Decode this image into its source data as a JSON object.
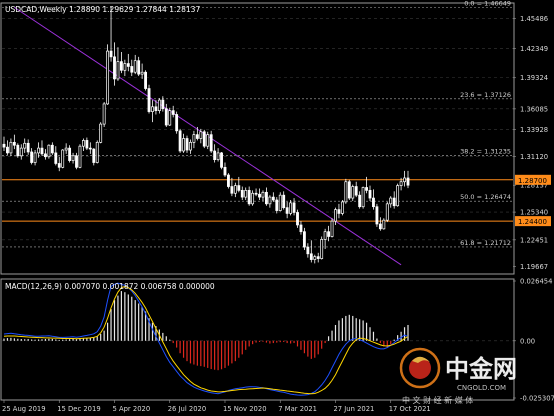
{
  "chart_data": [
    {
      "type": "candlestick",
      "header": "USDCAD,Weekly  1.28890 1.29629 1.27844 1.28137",
      "symbol": "USDCAD",
      "timeframe": "Weekly",
      "ohlc_last": {
        "open": 1.2889,
        "high": 1.29629,
        "low": 1.27844,
        "close": 1.28137
      },
      "ylim": [
        1.19667,
        1.46649
      ],
      "y_ticks": [
        "1.45486",
        "1.42349",
        "1.39324",
        "1.36085",
        "1.33928",
        "1.31120",
        "1.28137",
        "1.25340",
        "1.22451",
        "1.19667"
      ],
      "x_ticks": [
        "25 Aug 2019",
        "15 Dec 2019",
        "5 Apr 2020",
        "26 Jul 2020",
        "15 Nov 2020",
        "7 Mar 2021",
        "27 Jun 2021",
        "17 Oct 2021"
      ],
      "fib_levels": [
        {
          "label": "0.0 = 1.46649",
          "value": 1.46649
        },
        {
          "label": "23.6 = 1.37126",
          "value": 1.37126
        },
        {
          "label": "38.2 = 1.31235",
          "value": 1.31235
        },
        {
          "label": "50.0 = 1.26474",
          "value": 1.26474
        },
        {
          "label": "61.8 = 1.21712",
          "value": 1.21712
        }
      ],
      "horizontal_lines": [
        {
          "label": "1.28700",
          "value": 1.287,
          "color": "#ff8c1a"
        },
        {
          "label": "1.24400",
          "value": 1.244,
          "color": "#ff8c1a"
        }
      ],
      "current_price_label": "1.28137",
      "trendline": {
        "from": [
          3,
          1.4665
        ],
        "to": [
          115,
          1.1985
        ],
        "color": "#9b30d9"
      },
      "candles": [
        [
          1.324,
          1.332,
          1.317,
          1.321
        ],
        [
          1.321,
          1.328,
          1.313,
          1.315
        ],
        [
          1.315,
          1.33,
          1.312,
          1.326
        ],
        [
          1.326,
          1.334,
          1.319,
          1.323
        ],
        [
          1.323,
          1.325,
          1.31,
          1.312
        ],
        [
          1.312,
          1.324,
          1.308,
          1.32
        ],
        [
          1.32,
          1.33,
          1.315,
          1.325
        ],
        [
          1.325,
          1.329,
          1.313,
          1.316
        ],
        [
          1.316,
          1.32,
          1.303,
          1.305
        ],
        [
          1.305,
          1.318,
          1.302,
          1.315
        ],
        [
          1.315,
          1.326,
          1.31,
          1.32
        ],
        [
          1.32,
          1.328,
          1.312,
          1.314
        ],
        [
          1.314,
          1.319,
          1.308,
          1.311
        ],
        [
          1.311,
          1.324,
          1.309,
          1.323
        ],
        [
          1.323,
          1.326,
          1.313,
          1.315
        ],
        [
          1.315,
          1.322,
          1.302,
          1.304
        ],
        [
          1.304,
          1.311,
          1.296,
          1.3
        ],
        [
          1.3,
          1.319,
          1.299,
          1.318
        ],
        [
          1.318,
          1.325,
          1.314,
          1.32
        ],
        [
          1.32,
          1.323,
          1.305,
          1.307
        ],
        [
          1.307,
          1.315,
          1.304,
          1.312
        ],
        [
          1.312,
          1.315,
          1.298,
          1.3
        ],
        [
          1.3,
          1.324,
          1.299,
          1.322
        ],
        [
          1.322,
          1.33,
          1.317,
          1.328
        ],
        [
          1.328,
          1.331,
          1.318,
          1.32
        ],
        [
          1.32,
          1.326,
          1.314,
          1.319
        ],
        [
          1.319,
          1.32,
          1.302,
          1.305
        ],
        [
          1.305,
          1.328,
          1.304,
          1.326
        ],
        [
          1.326,
          1.347,
          1.325,
          1.345
        ],
        [
          1.345,
          1.368,
          1.342,
          1.366
        ],
        [
          1.366,
          1.428,
          1.365,
          1.421
        ],
        [
          1.421,
          1.467,
          1.41,
          1.415
        ],
        [
          1.415,
          1.43,
          1.385,
          1.392
        ],
        [
          1.392,
          1.425,
          1.39,
          1.41
        ],
        [
          1.41,
          1.42,
          1.398,
          1.401
        ],
        [
          1.401,
          1.412,
          1.395,
          1.408
        ],
        [
          1.408,
          1.418,
          1.4,
          1.405
        ],
        [
          1.405,
          1.412,
          1.395,
          1.399
        ],
        [
          1.399,
          1.417,
          1.397,
          1.411
        ],
        [
          1.411,
          1.415,
          1.395,
          1.397
        ],
        [
          1.397,
          1.408,
          1.392,
          1.399
        ],
        [
          1.399,
          1.401,
          1.38,
          1.382
        ],
        [
          1.382,
          1.386,
          1.356,
          1.358
        ],
        [
          1.358,
          1.37,
          1.347,
          1.363
        ],
        [
          1.363,
          1.37,
          1.355,
          1.359
        ],
        [
          1.359,
          1.372,
          1.356,
          1.37
        ],
        [
          1.37,
          1.374,
          1.358,
          1.361
        ],
        [
          1.361,
          1.366,
          1.342,
          1.344
        ],
        [
          1.344,
          1.362,
          1.343,
          1.359
        ],
        [
          1.359,
          1.364,
          1.352,
          1.355
        ],
        [
          1.355,
          1.358,
          1.335,
          1.338
        ],
        [
          1.338,
          1.34,
          1.315,
          1.317
        ],
        [
          1.317,
          1.335,
          1.315,
          1.33
        ],
        [
          1.33,
          1.333,
          1.315,
          1.318
        ],
        [
          1.318,
          1.329,
          1.314,
          1.326
        ],
        [
          1.326,
          1.338,
          1.32,
          1.334
        ],
        [
          1.334,
          1.342,
          1.328,
          1.33
        ],
        [
          1.33,
          1.34,
          1.325,
          1.337
        ],
        [
          1.337,
          1.339,
          1.32,
          1.322
        ],
        [
          1.322,
          1.337,
          1.319,
          1.334
        ],
        [
          1.334,
          1.338,
          1.315,
          1.317
        ],
        [
          1.317,
          1.324,
          1.305,
          1.308
        ],
        [
          1.308,
          1.32,
          1.306,
          1.315
        ],
        [
          1.315,
          1.316,
          1.298,
          1.3
        ],
        [
          1.3,
          1.305,
          1.29,
          1.292
        ],
        [
          1.292,
          1.294,
          1.278,
          1.28
        ],
        [
          1.28,
          1.289,
          1.27,
          1.273
        ],
        [
          1.273,
          1.284,
          1.269,
          1.281
        ],
        [
          1.281,
          1.29,
          1.274,
          1.276
        ],
        [
          1.276,
          1.28,
          1.266,
          1.269
        ],
        [
          1.269,
          1.279,
          1.266,
          1.276
        ],
        [
          1.276,
          1.28,
          1.26,
          1.262
        ],
        [
          1.262,
          1.276,
          1.26,
          1.273
        ],
        [
          1.273,
          1.278,
          1.27,
          1.272
        ],
        [
          1.272,
          1.278,
          1.266,
          1.269
        ],
        [
          1.269,
          1.276,
          1.265,
          1.274
        ],
        [
          1.274,
          1.279,
          1.26,
          1.262
        ],
        [
          1.262,
          1.271,
          1.258,
          1.269
        ],
        [
          1.269,
          1.274,
          1.264,
          1.266
        ],
        [
          1.266,
          1.269,
          1.252,
          1.255
        ],
        [
          1.255,
          1.274,
          1.254,
          1.271
        ],
        [
          1.271,
          1.275,
          1.256,
          1.258
        ],
        [
          1.258,
          1.264,
          1.247,
          1.252
        ],
        [
          1.252,
          1.266,
          1.25,
          1.263
        ],
        [
          1.263,
          1.268,
          1.25,
          1.253
        ],
        [
          1.253,
          1.256,
          1.237,
          1.24
        ],
        [
          1.24,
          1.244,
          1.23,
          1.233
        ],
        [
          1.233,
          1.237,
          1.214,
          1.217
        ],
        [
          1.217,
          1.221,
          1.206,
          1.21
        ],
        [
          1.21,
          1.224,
          1.201,
          1.204
        ],
        [
          1.204,
          1.209,
          1.2,
          1.207
        ],
        [
          1.207,
          1.211,
          1.201,
          1.205
        ],
        [
          1.205,
          1.228,
          1.204,
          1.225
        ],
        [
          1.225,
          1.236,
          1.215,
          1.233
        ],
        [
          1.233,
          1.239,
          1.223,
          1.228
        ],
        [
          1.228,
          1.247,
          1.227,
          1.244
        ],
        [
          1.244,
          1.258,
          1.24,
          1.256
        ],
        [
          1.256,
          1.262,
          1.247,
          1.252
        ],
        [
          1.252,
          1.266,
          1.25,
          1.264
        ],
        [
          1.264,
          1.288,
          1.262,
          1.285
        ],
        [
          1.285,
          1.287,
          1.266,
          1.268
        ],
        [
          1.268,
          1.282,
          1.265,
          1.28
        ],
        [
          1.28,
          1.285,
          1.269,
          1.271
        ],
        [
          1.271,
          1.275,
          1.257,
          1.259
        ],
        [
          1.259,
          1.28,
          1.257,
          1.279
        ],
        [
          1.279,
          1.29,
          1.273,
          1.276
        ],
        [
          1.276,
          1.281,
          1.265,
          1.268
        ],
        [
          1.268,
          1.277,
          1.256,
          1.259
        ],
        [
          1.259,
          1.262,
          1.238,
          1.241
        ],
        [
          1.241,
          1.248,
          1.234,
          1.236
        ],
        [
          1.236,
          1.247,
          1.235,
          1.245
        ],
        [
          1.245,
          1.264,
          1.243,
          1.262
        ],
        [
          1.262,
          1.27,
          1.258,
          1.268
        ],
        [
          1.268,
          1.275,
          1.257,
          1.26
        ],
        [
          1.26,
          1.283,
          1.259,
          1.281
        ],
        [
          1.281,
          1.289,
          1.276,
          1.285
        ],
        [
          1.285,
          1.2963,
          1.28,
          1.2889
        ],
        [
          1.2889,
          1.2963,
          1.2784,
          1.2814
        ]
      ]
    },
    {
      "type": "macd",
      "header": "MACD(12,26,9) 0.007070 0.001872 0.006758 0.000000",
      "params": "MACD(12,26,9)",
      "values_label": [
        "0.007070",
        "0.001872",
        "0.006758",
        "0.000000"
      ],
      "ylim": [
        -0.025307,
        0.026454
      ],
      "y_ticks": [
        "0.026454",
        "0.00",
        "-0.025307"
      ],
      "signal_color": "#ffd700",
      "main_line_color": "#1e50ff",
      "histogram": [
        0.001,
        0.0012,
        0.0013,
        0.0011,
        0.0009,
        0.0008,
        0.0007,
        0.0008,
        0.0006,
        0.0005,
        0.0006,
        0.0007,
        0.0008,
        0.0009,
        0.0008,
        0.0006,
        0.0004,
        0.0005,
        0.0006,
        0.0007,
        0.0008,
        0.0007,
        0.0008,
        0.001,
        0.0012,
        0.0014,
        0.0016,
        0.002,
        0.003,
        0.0045,
        0.008,
        0.014,
        0.018,
        0.02,
        0.022,
        0.0215,
        0.0205,
        0.0195,
        0.018,
        0.0165,
        0.015,
        0.013,
        0.01,
        0.008,
        0.0065,
        0.005,
        0.0035,
        0.002,
        0.0005,
        -0.001,
        -0.003,
        -0.0055,
        -0.0075,
        -0.009,
        -0.01,
        -0.0105,
        -0.011,
        -0.0112,
        -0.0115,
        -0.012,
        -0.0125,
        -0.0128,
        -0.013,
        -0.0126,
        -0.012,
        -0.011,
        -0.01,
        -0.009,
        -0.0075,
        -0.006,
        -0.004,
        -0.0025,
        -0.0015,
        -0.0008,
        -0.0005,
        -0.0004,
        -0.0008,
        -0.0012,
        -0.001,
        -0.0008,
        -0.0006,
        -0.0005,
        -0.001,
        -0.0012,
        -0.001,
        -0.0025,
        -0.004,
        -0.0055,
        -0.007,
        -0.008,
        -0.0075,
        -0.006,
        -0.0035,
        -0.001,
        0.002,
        0.0045,
        0.007,
        0.009,
        0.01,
        0.011,
        0.0115,
        0.011,
        0.01,
        0.0095,
        0.009,
        0.008,
        0.006,
        0.004,
        0.001,
        -0.001,
        -0.0025,
        -0.003,
        -0.0015,
        0.0005,
        0.0025,
        0.004,
        0.006,
        0.007
      ],
      "signal": [
        0.002,
        0.0021,
        0.0021,
        0.0021,
        0.002,
        0.0019,
        0.0018,
        0.0017,
        0.0016,
        0.0015,
        0.0014,
        0.0014,
        0.0013,
        0.0013,
        0.0012,
        0.0012,
        0.0011,
        0.001,
        0.001,
        0.001,
        0.001,
        0.0009,
        0.001,
        0.0011,
        0.0012,
        0.0013,
        0.0015,
        0.002,
        0.0035,
        0.006,
        0.01,
        0.0145,
        0.0185,
        0.0215,
        0.0235,
        0.024,
        0.0235,
        0.0225,
        0.021,
        0.019,
        0.017,
        0.0145,
        0.0115,
        0.0085,
        0.0055,
        0.0025,
        -0.0005,
        -0.0035,
        -0.0065,
        -0.009,
        -0.011,
        -0.013,
        -0.015,
        -0.0165,
        -0.018,
        -0.0192,
        -0.02,
        -0.0208,
        -0.0213,
        -0.0218,
        -0.0222,
        -0.0224,
        -0.0226,
        -0.0225,
        -0.0224,
        -0.0222,
        -0.022,
        -0.0218,
        -0.0216,
        -0.0215,
        -0.0214,
        -0.0213,
        -0.0212,
        -0.0211,
        -0.021,
        -0.0209,
        -0.021,
        -0.0212,
        -0.0214,
        -0.0216,
        -0.0218,
        -0.022,
        -0.0222,
        -0.0224,
        -0.0226,
        -0.0228,
        -0.023,
        -0.0232,
        -0.0233,
        -0.0234,
        -0.0233,
        -0.0228,
        -0.022,
        -0.021,
        -0.0195,
        -0.0175,
        -0.015,
        -0.012,
        -0.009,
        -0.006,
        -0.003,
        -0.001,
        0.0005,
        0.0012,
        0.001,
        0.0006,
        0.0,
        -0.0006,
        -0.0012,
        -0.0018,
        -0.0022,
        -0.0023,
        -0.002,
        -0.0015,
        -0.0008,
        -0.0002,
        0.001,
        0.0019
      ],
      "main_line": [
        0.003,
        0.0032,
        0.0033,
        0.0031,
        0.0029,
        0.0027,
        0.0025,
        0.0024,
        0.0022,
        0.002,
        0.002,
        0.0021,
        0.0021,
        0.0022,
        0.002,
        0.0018,
        0.0015,
        0.0015,
        0.0016,
        0.0017,
        0.0018,
        0.0016,
        0.0018,
        0.0021,
        0.0024,
        0.0027,
        0.0031,
        0.004,
        0.0065,
        0.0105,
        0.018,
        0.024,
        0.025,
        0.0255,
        0.025,
        0.0245,
        0.0235,
        0.022,
        0.02,
        0.0175,
        0.015,
        0.012,
        0.0085,
        0.005,
        0.002,
        -0.001,
        -0.004,
        -0.007,
        -0.0095,
        -0.0115,
        -0.0135,
        -0.0155,
        -0.017,
        -0.0185,
        -0.0195,
        -0.0205,
        -0.0212,
        -0.0217,
        -0.0222,
        -0.0226,
        -0.023,
        -0.0232,
        -0.0234,
        -0.023,
        -0.0226,
        -0.022,
        -0.0216,
        -0.0212,
        -0.021,
        -0.0208,
        -0.0205,
        -0.0203,
        -0.0203,
        -0.0204,
        -0.0206,
        -0.0208,
        -0.0212,
        -0.0216,
        -0.0219,
        -0.0222,
        -0.0225,
        -0.0228,
        -0.0232,
        -0.0236,
        -0.0238,
        -0.024,
        -0.0241,
        -0.024,
        -0.0238,
        -0.0233,
        -0.0225,
        -0.0212,
        -0.0195,
        -0.0175,
        -0.015,
        -0.012,
        -0.009,
        -0.006,
        -0.0035,
        -0.0015,
        0.0,
        0.0008,
        0.001,
        0.0005,
        -0.0002,
        -0.001,
        -0.0018,
        -0.0026,
        -0.0032,
        -0.0036,
        -0.0036,
        -0.003,
        -0.002,
        -0.0008,
        0.0005,
        0.0015,
        0.0025,
        0.0019
      ]
    }
  ],
  "watermark": {
    "brand": "中金网",
    "domain": "CNGOLD.COM",
    "tagline": "中 文 财 经 新 媒 体"
  }
}
